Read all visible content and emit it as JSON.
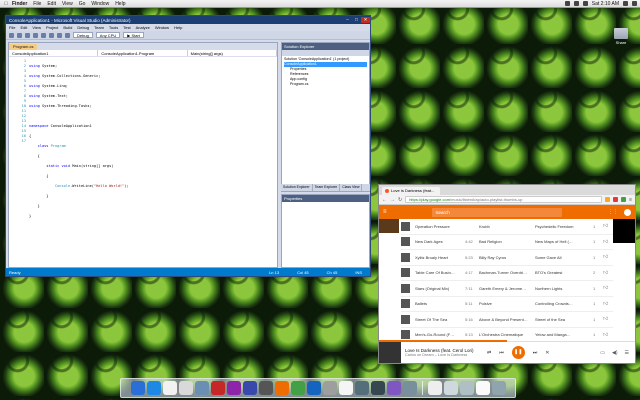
{
  "menubar": {
    "apple": "",
    "items": [
      "Finder",
      "File",
      "Edit",
      "View",
      "Go",
      "Window",
      "Help"
    ],
    "clock": "Sat 2:10 AM"
  },
  "desktop": {
    "folder_label": "Share"
  },
  "vs": {
    "title": "ConsoleApplication1 - Microsoft Visual Studio (Administrator)",
    "menu": [
      "File",
      "Edit",
      "View",
      "Project",
      "Build",
      "Debug",
      "Team",
      "Tools",
      "Test",
      "Analyze",
      "Window",
      "Help"
    ],
    "config": "Debug",
    "platform": "Any CPU",
    "start": "▶ Start",
    "editor_tab": "Program.cs",
    "nav_left": "ConsoleApplication1",
    "nav_mid": "ConsoleApplication1.Program",
    "nav_right": "Main(string[] args)",
    "line_numbers": [
      "1",
      "2",
      "3",
      "4",
      "5",
      "6",
      "7",
      "8",
      "9",
      "10",
      "11",
      "12",
      "13",
      "14",
      "15",
      "16",
      "17"
    ],
    "code": {
      "l1_kw": "using",
      "l1_rest": " System;",
      "l2_kw": "using",
      "l2_rest": " System.Collections.Generic;",
      "l3_kw": "using",
      "l3_rest": " System.Linq;",
      "l4_kw": "using",
      "l4_rest": " System.Text;",
      "l5_kw": "using",
      "l5_rest": " System.Threading.Tasks;",
      "l7_kw": "namespace",
      "l7_rest": " ConsoleApplication1",
      "l8": "{",
      "l9_kw": "class",
      "l9_ty": " Program",
      "l10": "    {",
      "l11_kw": "static void",
      "l11_rest": " Main(string[] args)",
      "l12": "        {",
      "l13_ty": "Console",
      "l13_mid": ".WriteLine(",
      "l13_st": "\"Hello World!\"",
      "l13_end": ");",
      "l14": "        }",
      "l15": "    }",
      "l16": "}"
    },
    "solution_title": "Solution Explorer",
    "tree": [
      "Solution 'ConsoleApplication1' (1 project)",
      "ConsoleApplication1",
      "Properties",
      "References",
      "App.config",
      "Program.cs"
    ],
    "bottom_tabs": [
      "Solution Explorer",
      "Team Explorer",
      "Class View"
    ],
    "properties_title": "Properties",
    "status": {
      "ready": "Ready",
      "ln": "Ln 13",
      "col": "Col 45",
      "ch": "Ch 45",
      "ins": "INS"
    }
  },
  "chrome": {
    "tab_title": "Love Is Darkness (feat...",
    "url_host": "https://play.google.com",
    "url_rest": "/music/listen#/ap/auto-playlist-thumbs-up",
    "search_placeholder": "Search",
    "songs": [
      {
        "title": "Operation Pressure",
        "dur": "",
        "artist": "Krubb",
        "album": "Psychedelic Freedom",
        "plays": "1"
      },
      {
        "title": "New Dark Ages",
        "dur": "4:42",
        "artist": "Bad Religion",
        "album": "New Maps of Hell (…",
        "plays": "1"
      },
      {
        "title": "Xylitz Broaly Heart",
        "dur": "5:23",
        "artist": "Billy Ray Cyrus",
        "album": "Some Gave All",
        "plays": "1"
      },
      {
        "title": "Table Care Of Busin…",
        "dur": "4:17",
        "artist": "Bachman-Turner Overdri…",
        "album": "BTO's Greatest",
        "plays": "2"
      },
      {
        "title": "Stars (Original Mix)",
        "dur": "7:11",
        "artist": "Gareth Emery & Jerome…",
        "album": "Northern Lights",
        "plays": "1"
      },
      {
        "title": "Ballets",
        "dur": "5:11",
        "artist": "Pulsive",
        "album": "Controlling Crowds…",
        "plays": "1"
      },
      {
        "title": "Street Of The Sea",
        "dur": "5:16",
        "artist": "Above & Beyond Present…",
        "album": "Street of the Sea",
        "plays": "1"
      },
      {
        "title": "Men's-Go-Round (F…",
        "dur": "5:13",
        "artist": "L'Orchestra Cinematique",
        "album": "Yelow and Manga…",
        "plays": "1"
      }
    ],
    "player": {
      "title": "Love Is Darkness (feat. Cerol Lori)",
      "artist": "Carlos on Dream – Love Is Darkness",
      "progress": 0.5
    }
  },
  "dock_colors": [
    "#2a6fd6",
    "#1e88e5",
    "#f2f2f2",
    "#d9d9d9",
    "#6b8fb3",
    "#c62828",
    "#8e24aa",
    "#3949ab",
    "#555555",
    "#ef6c00",
    "#43a047",
    "#1565c0",
    "#9e9e9e",
    "#f5f5f5",
    "#546e7a",
    "#37474f",
    "#7e57c2",
    "#78909c",
    "#eeeeee",
    "#cfd8dc",
    "#b0bec5",
    "#fafafa",
    "#90a4ae"
  ]
}
